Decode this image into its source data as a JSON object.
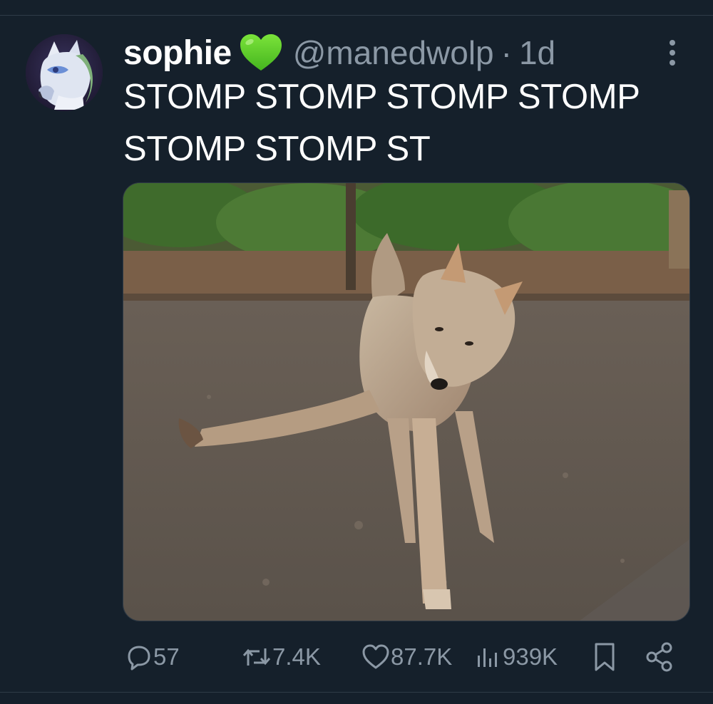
{
  "tweet": {
    "author": {
      "display_name": "sophie",
      "emoji_badge": "green-heart-emoji",
      "handle": "@manedwolp",
      "separator": "·",
      "age": "1d"
    },
    "text": "STOMP STOMP STOMP STOMP STOMP STOMP ST",
    "media": {
      "subject": "wolf-photo"
    }
  },
  "actions": {
    "replies": "57",
    "reposts": "7.4K",
    "likes": "87.7K",
    "views": "939K"
  },
  "colors": {
    "background": "#15202b",
    "secondary_text": "#8b98a5",
    "heart_emoji": "#5fd32a"
  }
}
